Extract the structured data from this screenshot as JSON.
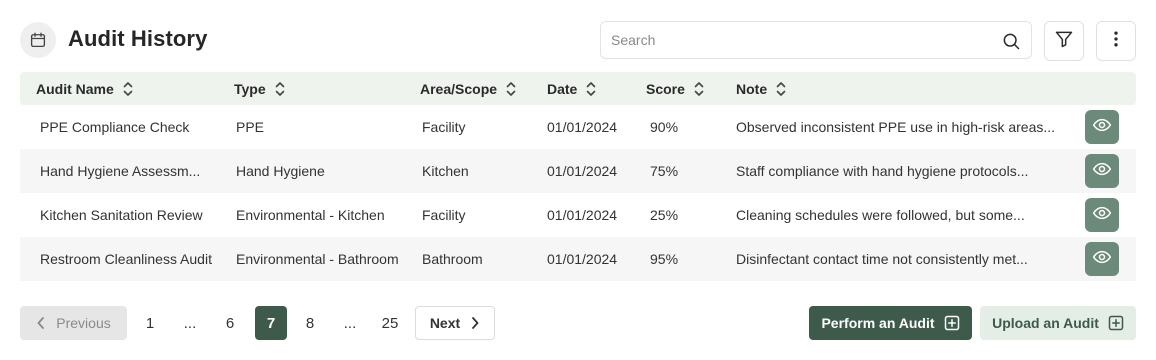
{
  "header": {
    "title": "Audit History",
    "calendar_icon": "calendar-icon",
    "search_placeholder": "Search",
    "search_value": "",
    "search_icon": "search-icon",
    "filter_icon": "filter-icon",
    "more_icon": "more-vertical-icon"
  },
  "table": {
    "columns": [
      {
        "label": "Audit Name"
      },
      {
        "label": "Type"
      },
      {
        "label": "Area/Scope"
      },
      {
        "label": "Date"
      },
      {
        "label": "Score"
      },
      {
        "label": "Note"
      }
    ],
    "rows": [
      {
        "name": "PPE Compliance Check",
        "type": "PPE",
        "area": "Facility",
        "date": "01/01/2024",
        "score": "90%",
        "note": "Observed inconsistent PPE use in high-risk areas..."
      },
      {
        "name": "Hand Hygiene Assessm...",
        "type": "Hand Hygiene",
        "area": "Kitchen",
        "date": "01/01/2024",
        "score": "75%",
        "note": "Staff compliance with hand hygiene protocols..."
      },
      {
        "name": "Kitchen Sanitation Review",
        "type": "Environmental - Kitchen",
        "area": "Facility",
        "date": "01/01/2024",
        "score": "25%",
        "note": "Cleaning schedules were followed, but some..."
      },
      {
        "name": "Restroom Cleanliness Audit",
        "type": "Environmental - Bathroom",
        "area": "Bathroom",
        "date": "01/01/2024",
        "score": "95%",
        "note": "Disinfectant contact time not consistently met..."
      }
    ],
    "view_icon": "eye-icon"
  },
  "pagination": {
    "previous_label": "Previous",
    "next_label": "Next",
    "pages": [
      "1",
      "...",
      "6",
      "7",
      "8",
      "...",
      "25"
    ],
    "current_page": "7"
  },
  "actions": {
    "perform_label": "Perform an Audit",
    "upload_label": "Upload an Audit"
  },
  "colors": {
    "primary": "#3d5a4a",
    "view_button": "#6b8a79",
    "header_row": "#eef3ee",
    "upload_bg": "#e4ede6"
  }
}
